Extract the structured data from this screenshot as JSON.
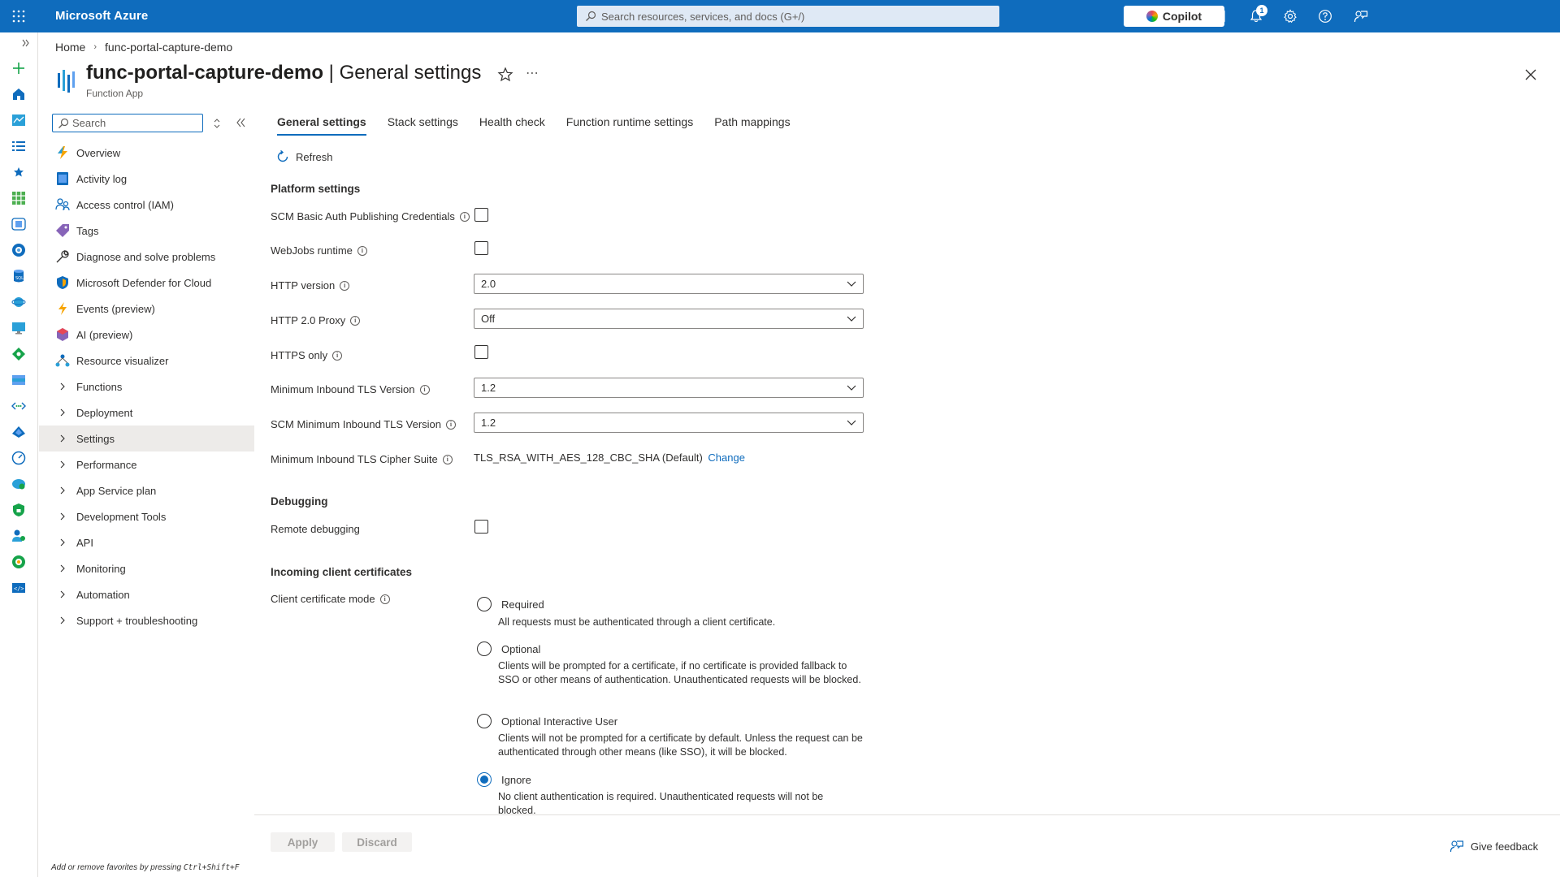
{
  "topbar": {
    "brand": "Microsoft Azure",
    "search_placeholder": "Search resources, services, and docs (G+/)",
    "copilot_label": "Copilot",
    "notification_count": "1"
  },
  "breadcrumb": {
    "home": "Home",
    "current": "func-portal-capture-demo"
  },
  "header": {
    "resource_name": "func-portal-capture-demo",
    "separator": " | ",
    "page_name": "General settings",
    "subtitle": "Function App"
  },
  "menu": {
    "search_placeholder": "Search",
    "items": [
      {
        "label": "Overview",
        "icon": "lightning-icon"
      },
      {
        "label": "Activity log",
        "icon": "activity-log-icon"
      },
      {
        "label": "Access control (IAM)",
        "icon": "iam-icon"
      },
      {
        "label": "Tags",
        "icon": "tag-icon"
      },
      {
        "label": "Diagnose and solve problems",
        "icon": "wrench-icon"
      },
      {
        "label": "Microsoft Defender for Cloud",
        "icon": "shield-icon"
      },
      {
        "label": "Events (preview)",
        "icon": "bolt-icon"
      },
      {
        "label": "AI (preview)",
        "icon": "ai-icon"
      },
      {
        "label": "Resource visualizer",
        "icon": "visualizer-icon"
      }
    ],
    "groups": [
      "Functions",
      "Deployment",
      "Settings",
      "Performance",
      "App Service plan",
      "Development Tools",
      "API",
      "Monitoring",
      "Automation",
      "Support + troubleshooting"
    ],
    "selected_group": "Settings",
    "footer_text": "Add or remove favorites by pressing ",
    "footer_keys": "Ctrl+Shift+F"
  },
  "tabs": [
    "General settings",
    "Stack settings",
    "Health check",
    "Function runtime settings",
    "Path mappings"
  ],
  "active_tab": "General settings",
  "toolbar": {
    "refresh_label": "Refresh"
  },
  "platform": {
    "heading": "Platform settings",
    "scm_basic_auth_label": "SCM Basic Auth Publishing Credentials",
    "scm_basic_auth_checked": false,
    "webjobs_label": "WebJobs runtime",
    "webjobs_checked": false,
    "http_version_label": "HTTP version",
    "http_version_value": "2.0",
    "http2_proxy_label": "HTTP 2.0 Proxy",
    "http2_proxy_value": "Off",
    "https_only_label": "HTTPS only",
    "https_only_checked": false,
    "min_tls_label": "Minimum Inbound TLS Version",
    "min_tls_value": "1.2",
    "scm_min_tls_label": "SCM Minimum Inbound TLS Version",
    "scm_min_tls_value": "1.2",
    "cipher_label": "Minimum Inbound TLS Cipher Suite",
    "cipher_value": "TLS_RSA_WITH_AES_128_CBC_SHA (Default)",
    "cipher_change": "Change"
  },
  "debugging": {
    "heading": "Debugging",
    "remote_label": "Remote debugging",
    "remote_checked": false
  },
  "certs": {
    "heading": "Incoming client certificates",
    "mode_label": "Client certificate mode",
    "options": [
      {
        "label": "Required",
        "desc": "All requests must be authenticated through a client certificate."
      },
      {
        "label": "Optional",
        "desc": "Clients will be prompted for a certificate, if no certificate is provided fallback to SSO or other means of authentication. Unauthenticated requests will be blocked."
      },
      {
        "label": "Optional Interactive User",
        "desc": "Clients will not be prompted for a certificate by default. Unless the request can be authenticated through other means (like SSO), it will be blocked."
      },
      {
        "label": "Ignore",
        "desc": "No client authentication is required. Unauthenticated requests will not be blocked."
      }
    ],
    "selected": "Ignore"
  },
  "footer": {
    "apply_label": "Apply",
    "discard_label": "Discard",
    "feedback_label": "Give feedback"
  },
  "colors": {
    "accent": "#0f6cbd",
    "topbar": "#0f6cbd",
    "selected_bg": "#edebe9"
  }
}
